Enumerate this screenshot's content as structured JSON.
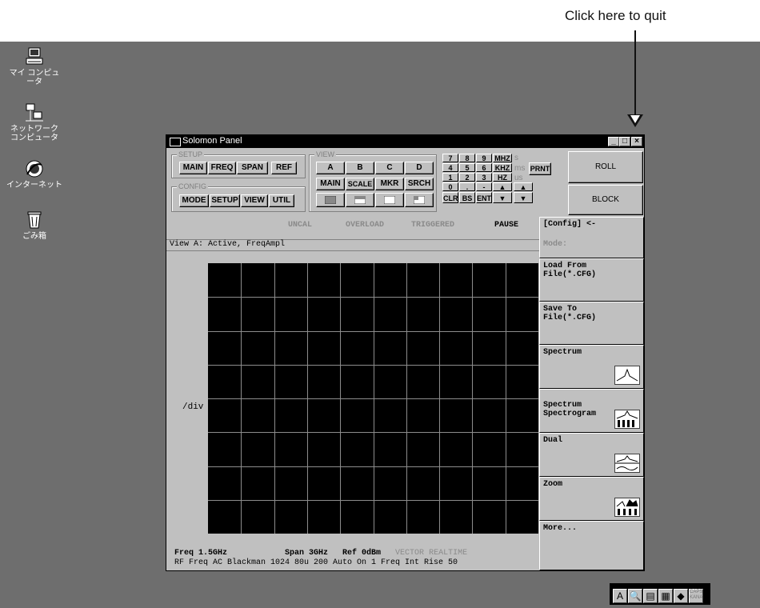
{
  "annotation": {
    "text": "Click here to quit"
  },
  "desktop_icons": [
    {
      "label": "マイ コンピュータ",
      "icon": "computer-icon"
    },
    {
      "label": "ネットワーク\nコンピュータ",
      "icon": "network-icon"
    },
    {
      "label": "インターネット",
      "icon": "internet-icon"
    },
    {
      "label": "ごみ箱",
      "icon": "recycle-bin-icon"
    }
  ],
  "window": {
    "title": "Solomon Panel",
    "controls": {
      "minimize": "_",
      "maximize": "□",
      "close": "×"
    }
  },
  "setup": {
    "label": "SETUP",
    "buttons": [
      "MAIN",
      "FREQ",
      "SPAN",
      "REF"
    ]
  },
  "config": {
    "label": "CONFIG",
    "buttons": [
      "MODE",
      "SETUP",
      "VIEW",
      "UTIL"
    ]
  },
  "view": {
    "label": "VIEW",
    "row1": [
      "A",
      "B",
      "C",
      "D"
    ],
    "row2": [
      "MAIN",
      "SCALE",
      "MKR",
      "SRCH"
    ]
  },
  "keypad": {
    "rows": [
      [
        "7",
        "8",
        "9",
        "MHZ"
      ],
      [
        "4",
        "5",
        "6",
        "KHZ"
      ],
      [
        "1",
        "2",
        "3",
        "HZ"
      ],
      [
        "0",
        ".",
        "-",
        "▲"
      ],
      [
        "CLR",
        "BS",
        "ENT",
        "▼"
      ]
    ],
    "extra_up": "▲",
    "extra_down": "▼",
    "units": [
      "s",
      "ms",
      "us"
    ],
    "print": "PRNT"
  },
  "roll": "ROLL",
  "block": "BLOCK",
  "status": {
    "uncal": "UNCAL",
    "overload": "OVERLOAD",
    "triggered": "TRIGGERED",
    "pause": "PAUSE"
  },
  "view_status": "View A: Active, FreqAmpl",
  "div_label": "/div",
  "bottom": {
    "line1": "Freq 1.5GHz            Span 3GHz   Ref 0dBm   ",
    "vector": "VECTOR",
    "realtime": "REALTIME",
    "line2": "RF Freq AC Blackman 1024 80u 200 Auto On 1 Freq Int Rise 50"
  },
  "right_menu": {
    "config_title": "[Config] <-",
    "mode_label": "Mode:",
    "items": [
      "Load From\nFile(*.CFG)",
      "Save To\nFile(*.CFG)",
      "Spectrum",
      "Spectrum\nSpectrogram",
      "Dual",
      "Zoom",
      "More..."
    ]
  },
  "tray": {
    "ime_letter": "A",
    "caps": "CAPS\nKANA"
  }
}
